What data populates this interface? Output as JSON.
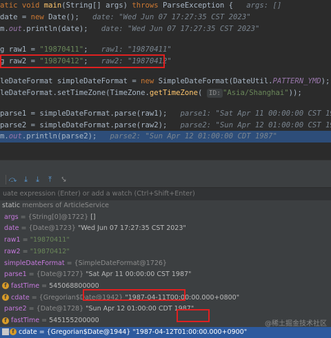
{
  "code": {
    "l1": {
      "kw1": "atic void ",
      "fn": "main",
      "p1": "(String[] args) ",
      "kw2": "throws ",
      "p2": "ParseException {",
      "hint": "   args: []"
    },
    "l2": {
      "pre": "date = ",
      "kw": "new ",
      "post": "Date();",
      "hint": "   date: \"Wed Jun 07 17:27:35 CST 2023\""
    },
    "l3": {
      "pre": "m.",
      "sf": "out",
      "post": ".println(date);",
      "hint": "   date: \"Wed Jun 07 17:27:35 CST 2023\""
    },
    "l4": {
      "pre": "g raw1 = ",
      "str": "\"19870411\"",
      "post": ";",
      "hint": "   raw1: \"19870411\""
    },
    "l5": {
      "pre": "g raw2 = ",
      "str": "\"19870412\"",
      "post": ";",
      "hint": "   raw2: \"19870412\""
    },
    "l6": {
      "pre": "leDateFormat simpleDateFormat = ",
      "kw": "new ",
      "post": "SimpleDateFormat(DateUtil.",
      "sf": "PATTERN_YMD",
      "post2": ");",
      "hint": "   simpleDa"
    },
    "l7": {
      "pre": "leDateFormat.setTimeZone(TimeZone.",
      "fn": "getTimeZone",
      "post": "( ",
      "param": "ID:",
      "str": "\"Asia/Shanghai\"",
      "post2": "));"
    },
    "l8": {
      "pre": "parse1 = simpleDateFormat.parse(raw1);",
      "hint": "   parse1: \"Sat Apr 11 00:00:00 CST 1987\"",
      "tail": "   ra"
    },
    "l9": {
      "pre": "parse2 = simpleDateFormat.parse(raw2);",
      "hint": "   parse2: \"Sun Apr 12 01:00:00 CST 1987\"",
      "tail": "   ra"
    },
    "l10": {
      "pre": "m.",
      "sf": "out",
      "post": ".println(parse2);",
      "hint": "   parse2: \"Sun Apr 12 01:00:00 CDT 1987\""
    }
  },
  "evaluate": {
    "placeholder": "uate expression (Enter) or add a watch (Ctrl+Shift+Enter)"
  },
  "variables": [
    {
      "name": "static",
      "value": " members of ArticleService",
      "kind": "static"
    },
    {
      "name": "args",
      "type": " = {String[0]@1722} ",
      "value": "[]",
      "kind": "p"
    },
    {
      "name": "date",
      "type": " = {Date@1723} ",
      "value": "\"Wed Jun 07 17:27:35 CST 2023\"",
      "kind": "p"
    },
    {
      "name": "raw1",
      "type": " = ",
      "value": "\"19870411\"",
      "kind": "s"
    },
    {
      "name": "raw2",
      "type": " = ",
      "value": "\"19870412\"",
      "kind": "s"
    },
    {
      "name": "simpleDateFormat",
      "type": " = {SimpleDateFormat@1726}",
      "value": "",
      "kind": "p"
    },
    {
      "name": "parse1",
      "type": " = {Date@1727} ",
      "value": "\"Sat Apr 11 00:00:00 CST 1987\"",
      "kind": "p"
    },
    {
      "name": "fastTime",
      "type": " = ",
      "value": "545068800000",
      "kind": "f"
    },
    {
      "name": "cdate",
      "type": " = {Gregorian$Date@1942} ",
      "value": "\"1987-04-11T00:00:00.000+0800\"",
      "kind": "f"
    },
    {
      "name": "parse2",
      "type": " = {Date@1728} ",
      "value": "\"Sun Apr 12 01:00:00 CDT 1987\"",
      "kind": "p"
    },
    {
      "name": "fastTime",
      "type": " = ",
      "value": "545155200000",
      "kind": "f"
    },
    {
      "name": "cdate",
      "type": " = {Gregorian$Date@1944} ",
      "value": "\"1987-04-12T01:00:00.000+0900\"",
      "kind": "f"
    }
  ],
  "watermark": "@稀土掘金技术社区"
}
